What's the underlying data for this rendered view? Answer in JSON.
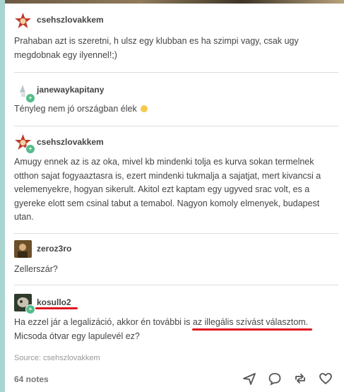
{
  "posts": [
    {
      "username": "csehszlovakkem",
      "text": "Prahaban azt is szeretni, h ulsz egy klubban es ha szimpi vagy, csak ugy megdobnak egy ilyennel!;)"
    },
    {
      "username": "janewaykapitany",
      "text": "Tényleg nem jó országban élek"
    },
    {
      "username": "csehszlovakkem",
      "text": "Amugy ennek az is az oka, mivel kb mindenki tolja es kurva sokan termelnek otthon sajat fogyaaztasra is, ezert mindenki tukmalja a sajatjat, mert kivancsi a velemenyekre, hogyan sikerult. Akitol ezt kaptam egy ugyved srac volt, es a gyereke elott sem csinal tabut a temabol. Nagyon komoly elmenyek, budapest utan."
    },
    {
      "username": "zeroz3ro",
      "text": "Zellerszár?"
    },
    {
      "username": "kosullo2",
      "text": "Ha ezzel jár a legalizáció, akkor én további is az illegális szívást választom. Micsoda ótvar egy lapulevél ez?"
    }
  ],
  "source": {
    "label": "Source:",
    "name": "csehszlovakkem"
  },
  "footer": {
    "notes": "64 notes"
  },
  "icons": [
    "share-icon",
    "reply-icon",
    "reblog-icon",
    "like-icon"
  ],
  "colors": {
    "highlight": "#e0151f",
    "badge": "#56bc8a",
    "stripe": "#a8d5cf"
  }
}
